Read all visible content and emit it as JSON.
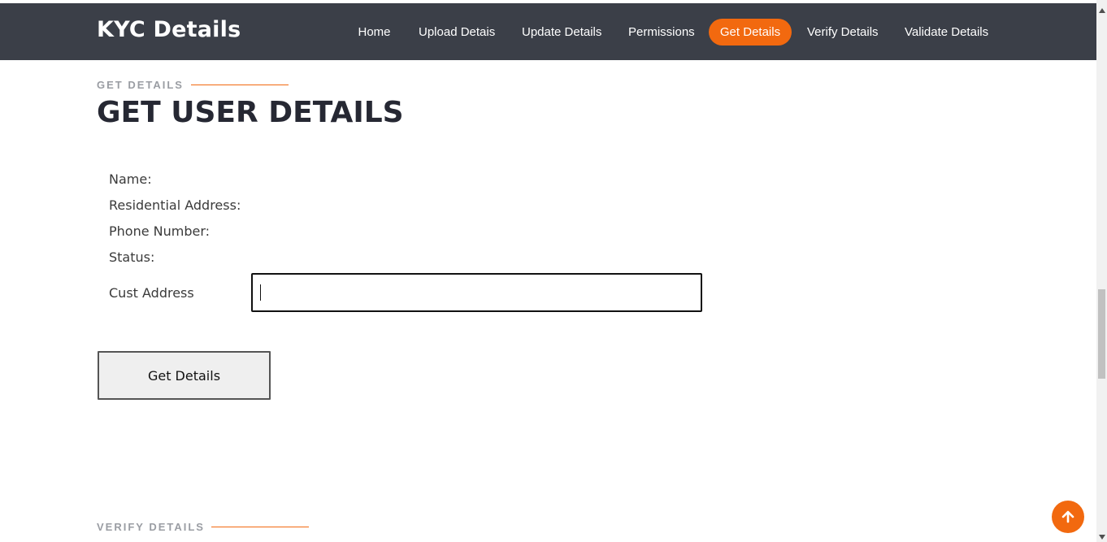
{
  "brand": "KYC Details",
  "nav": {
    "items": [
      {
        "label": "Home",
        "active": false
      },
      {
        "label": "Upload Detais",
        "active": false
      },
      {
        "label": "Update Details",
        "active": false
      },
      {
        "label": "Permissions",
        "active": false
      },
      {
        "label": "Get Details",
        "active": true
      },
      {
        "label": "Verify Details",
        "active": false
      },
      {
        "label": "Validate Details",
        "active": false
      }
    ]
  },
  "section": {
    "subtitle": "GET DETAILS",
    "title": "GET USER DETAILS"
  },
  "fields": {
    "name_label": "Name:",
    "address_label": "Residential Address:",
    "phone_label": "Phone Number:",
    "status_label": "Status:",
    "cust_address_label": "Cust Address",
    "cust_address_value": "",
    "cust_address_placeholder": ""
  },
  "button": {
    "get_details_label": "Get Details"
  },
  "next_section": {
    "subtitle": "VERIFY DETAILS"
  },
  "icons": {
    "back_to_top": "arrow-up-icon",
    "scroll_up": "triangle-up-icon",
    "scroll_down": "triangle-down-icon"
  },
  "colors": {
    "accent": "#f2690f",
    "navbar": "#3b3f48",
    "heading": "#262833"
  }
}
